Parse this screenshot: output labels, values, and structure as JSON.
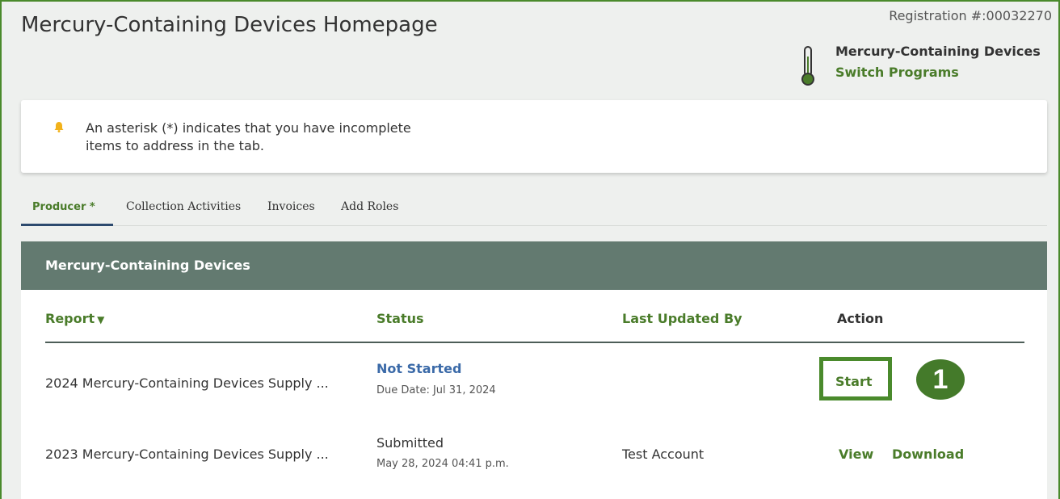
{
  "header": {
    "title": "Mercury-Containing Devices Homepage",
    "registration": "Registration #:00032270",
    "program_name": "Mercury-Containing Devices",
    "switch_programs": "Switch Programs",
    "program_icon": "thermometer-icon"
  },
  "alert": {
    "icon": "bell-icon",
    "text_line1": "An asterisk (*) indicates that you have incomplete",
    "text_line2": "items to address in the tab."
  },
  "tabs": [
    {
      "label": "Producer *",
      "active": true
    },
    {
      "label": "Collection Activities",
      "active": false
    },
    {
      "label": "Invoices",
      "active": false
    },
    {
      "label": "Add Roles",
      "active": false
    }
  ],
  "card": {
    "title": "Mercury-Containing Devices",
    "columns": {
      "report": "Report",
      "status": "Status",
      "last_updated_by": "Last Updated By",
      "action": "Action"
    },
    "rows": [
      {
        "report": "2024 Mercury-Containing Devices Supply ...",
        "status": "Not Started",
        "sub": "Due Date: Jul 31, 2024",
        "last_updated_by": "",
        "actions": [
          "Start"
        ]
      },
      {
        "report": "2023 Mercury-Containing Devices Supply ...",
        "status": "Submitted",
        "sub": "May 28, 2024 04:41 p.m.",
        "last_updated_by": "Test Account",
        "actions": [
          "View",
          "Download"
        ]
      }
    ],
    "step_badge": "1"
  },
  "colors": {
    "accent_green": "#4a7c2a",
    "header_bar": "#637a70",
    "status_blue": "#3b6aa8",
    "highlight": "#4a8a2c"
  }
}
